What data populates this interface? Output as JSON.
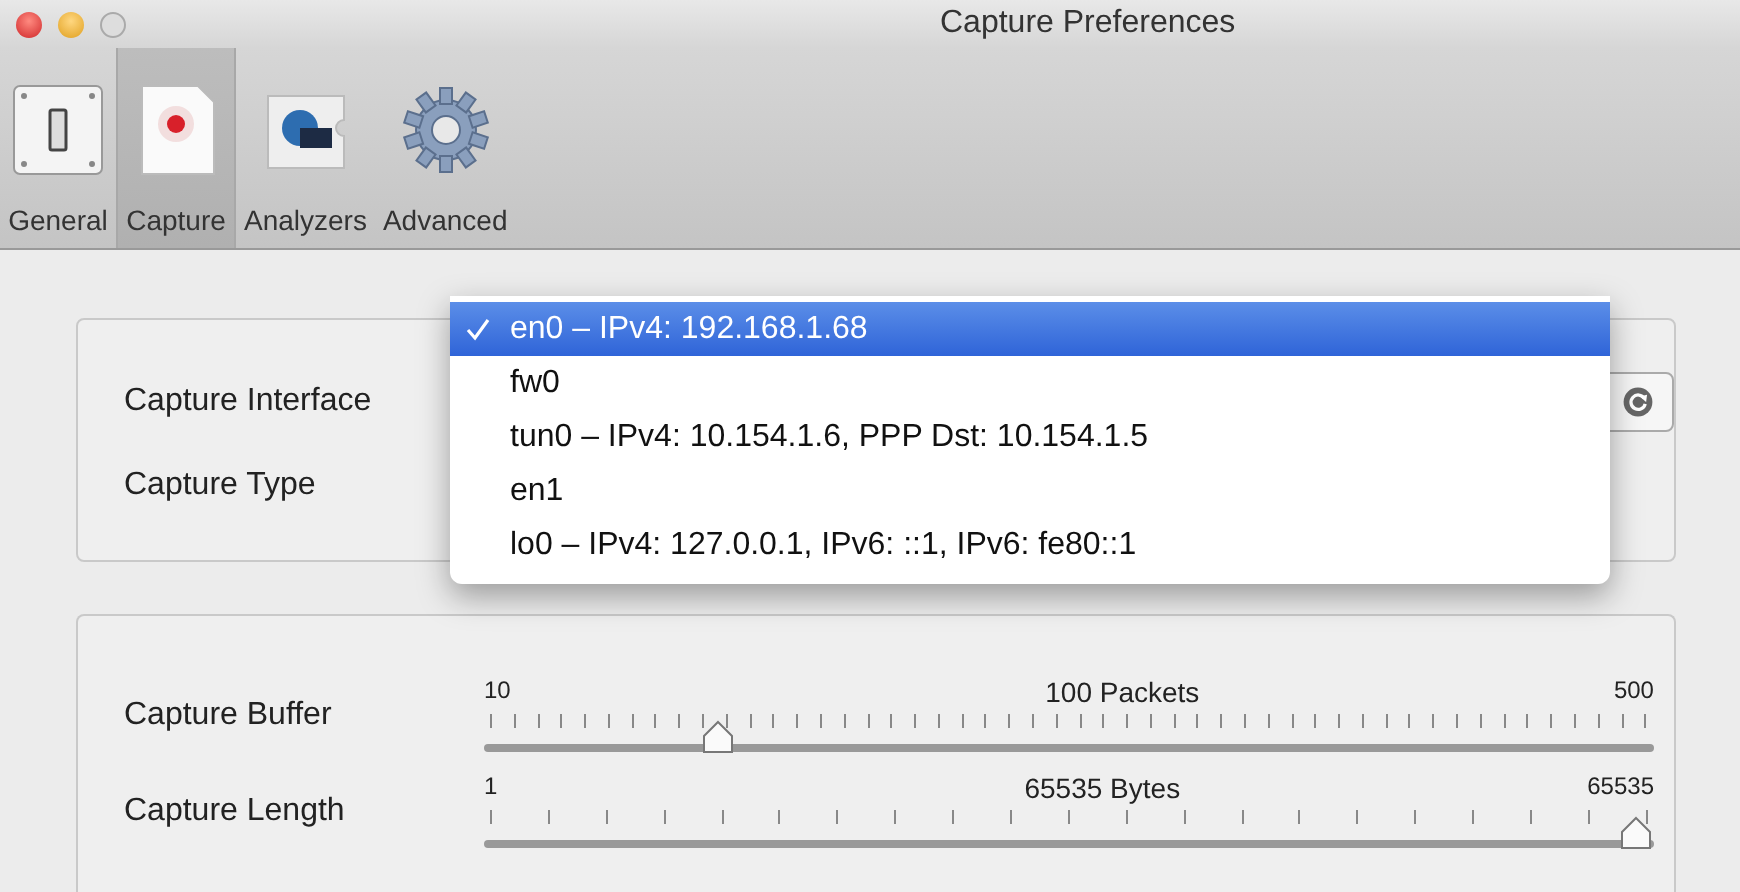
{
  "window": {
    "title": "Capture Preferences"
  },
  "toolbar": [
    {
      "label": "General",
      "kind": "switch",
      "selected": false
    },
    {
      "label": "Capture",
      "kind": "pcap",
      "selected": true
    },
    {
      "label": "Analyzers",
      "kind": "analyzers",
      "selected": false
    },
    {
      "label": "Advanced",
      "kind": "gear",
      "selected": false
    }
  ],
  "interface_box": {
    "interface_label": "Capture Interface",
    "type_label": "Capture Type",
    "menu": [
      {
        "label": "en0 – IPv4: 192.168.1.68",
        "selected": true
      },
      {
        "label": "fw0",
        "selected": false
      },
      {
        "label": "tun0 – IPv4: 10.154.1.6, PPP Dst: 10.154.1.5",
        "selected": false
      },
      {
        "label": "en1",
        "selected": false
      },
      {
        "label": "lo0 – IPv4: 127.0.0.1, IPv6: ::1, IPv6: fe80::1",
        "selected": false
      }
    ]
  },
  "sliders": [
    {
      "label": "Capture Buffer",
      "min": "10",
      "max": "500",
      "reading": "100 Packets",
      "level": 0.19
    },
    {
      "label": "Capture Length",
      "min": "1",
      "max": "65535",
      "reading": "65535 Bytes",
      "level": 1.0
    }
  ]
}
